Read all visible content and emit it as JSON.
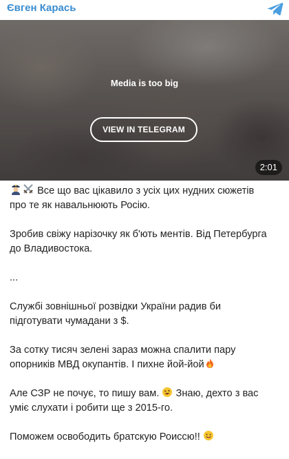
{
  "header": {
    "channel_name": "Євген Карась",
    "logo_icon": "telegram-icon"
  },
  "media": {
    "message": "Media is too big",
    "button_label": "VIEW IN TELEGRAM",
    "duration": "2:01"
  },
  "post": {
    "p1_line1": "Все що вас цікавило з усіх цих нудних сюжетів",
    "p1_line2": "про те як навальнюють Росію.",
    "p2_line1": "Зробив свіжу нарізочку як б'ють ментів. Від Петербурга",
    "p2_line2": "до Владивостока.",
    "p3": "...",
    "p4_line1": "Службі зовнішньої розвідки України радив би",
    "p4_line2": "підготувати чумадани з $.",
    "p5_line1": "За сотку тисяч зелені зараз можна спалити пару",
    "p5_line2": "опорників МВД окупантів. І пихне йой-йой",
    "p6_line1_a": "Але СЗР не почує, то пишу вам.",
    "p6_line1_b": "Знаю, дехто з вас",
    "p6_line2": "уміє слухати і робити ще з 2015-го.",
    "p7": "Поможем освободить братскую Роиссю!!"
  },
  "icons": {
    "p1_icons": [
      "police-officer-icon",
      "crossed-swords-icon"
    ],
    "p5_icon": "fire-icon",
    "p6_icon": "rofl-face-icon",
    "p7_icon": "tongue-face-icon"
  }
}
